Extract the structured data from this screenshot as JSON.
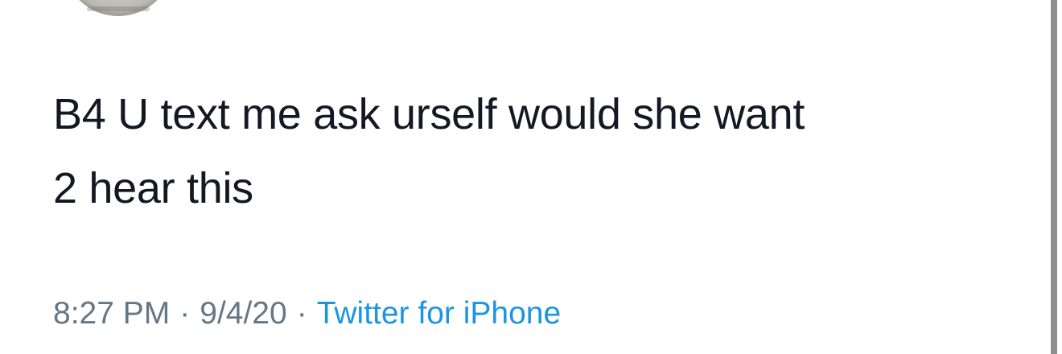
{
  "tweet": {
    "text": "B4 U text me ask urself would she want\n2 hear this",
    "time": "8:27 PM",
    "separator": "·",
    "date": "9/4/20",
    "source": "Twitter for iPhone",
    "source_color": "#1b95e0"
  }
}
